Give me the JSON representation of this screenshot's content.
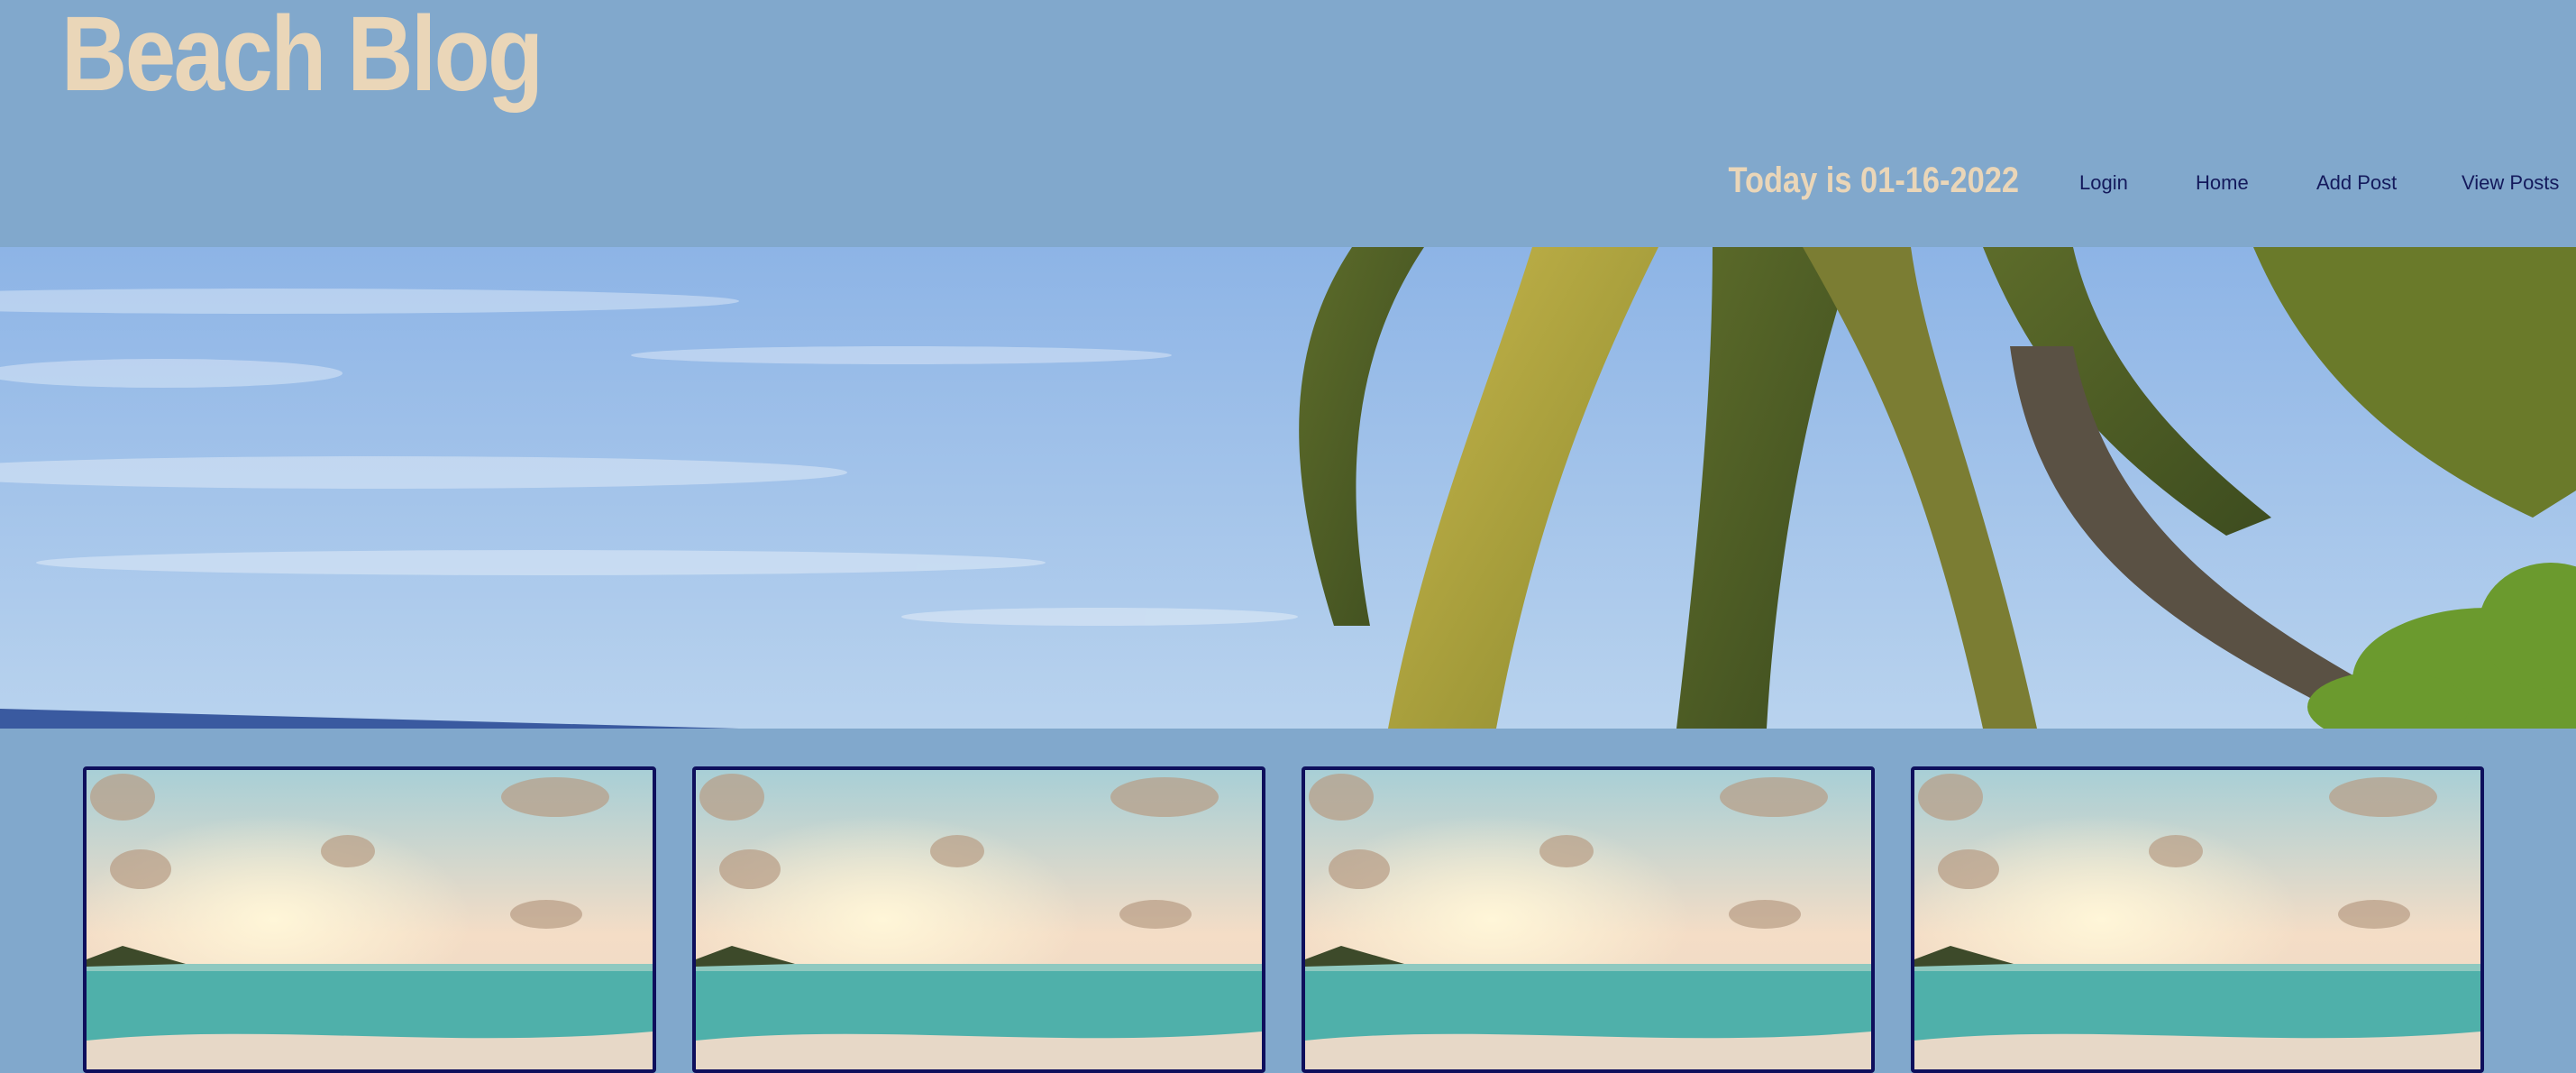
{
  "header": {
    "site_title": "Beach Blog",
    "today_text": "Today is 01-16-2022"
  },
  "nav": {
    "items": [
      {
        "label": "Login"
      },
      {
        "label": "Home"
      },
      {
        "label": "Add Post"
      },
      {
        "label": "View Posts"
      }
    ]
  },
  "hero": {
    "image": "palm-tree-beach-banner"
  },
  "posts": {
    "cards": [
      {
        "image": "sunset-beach-photo"
      },
      {
        "image": "sunset-beach-photo"
      },
      {
        "image": "sunset-beach-photo"
      },
      {
        "image": "sunset-beach-photo"
      }
    ]
  },
  "colors": {
    "background": "#81a8cc",
    "title": "#ead6b8",
    "nav_link": "#141a5c",
    "card_border": "#0e0f5c"
  }
}
